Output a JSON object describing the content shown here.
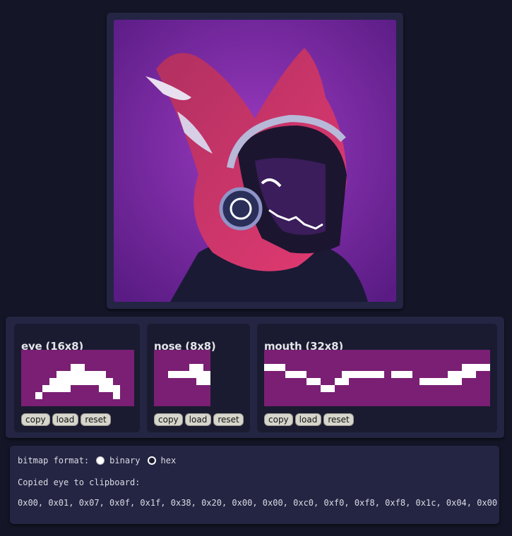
{
  "photo": {
    "alt_icon": "fursuit-helmet-photo",
    "colors": {
      "background": "#7a2aa0",
      "fur": "#d4306c",
      "helmet": "#1c1530",
      "led": "#ffffff"
    }
  },
  "editors": [
    {
      "id": "eye",
      "title": "eye (16x8)",
      "cols": 16,
      "rows": 8,
      "pixels": [
        "0000000000000000",
        "0000000000000000",
        "0000000110000000",
        "0000011111110000",
        "0000111111111000",
        "0001111000011100",
        "0010000000000100",
        "0000000000000000"
      ]
    },
    {
      "id": "nose",
      "title": "nose (8x8)",
      "cols": 8,
      "rows": 8,
      "pixels": [
        "00000000",
        "00000000",
        "00000110",
        "00111111",
        "00000011",
        "00000000",
        "00000000",
        "00000000"
      ]
    },
    {
      "id": "mouth",
      "title": "mouth (32x8)",
      "cols": 32,
      "rows": 8,
      "pixels": [
        "00000000000000000000000000000000",
        "00000000000000000000000000000000",
        "11100000000000000000000000001111",
        "00011100000111111011100000111100",
        "00000011001100000000001111110000",
        "00000000110000000000000000000000",
        "00000000000000000000000000000000",
        "00000000000000000000000000000000"
      ]
    }
  ],
  "buttons": {
    "copy": "copy",
    "load": "load",
    "reset": "reset"
  },
  "settings": {
    "format_label": "bitmap format:",
    "options": [
      {
        "label": "binary",
        "checked": false
      },
      {
        "label": "hex",
        "checked": true
      }
    ],
    "status": "Copied eye to clipboard:",
    "output": "0x00, 0x01, 0x07, 0x0f, 0x1f, 0x38, 0x20, 0x00, 0x00, 0xc0, 0xf0, 0xf8, 0xf8, 0x1c, 0x04, 0x00"
  },
  "colors": {
    "pixel_off": "#7a1f74",
    "pixel_on": "#ffffff"
  }
}
